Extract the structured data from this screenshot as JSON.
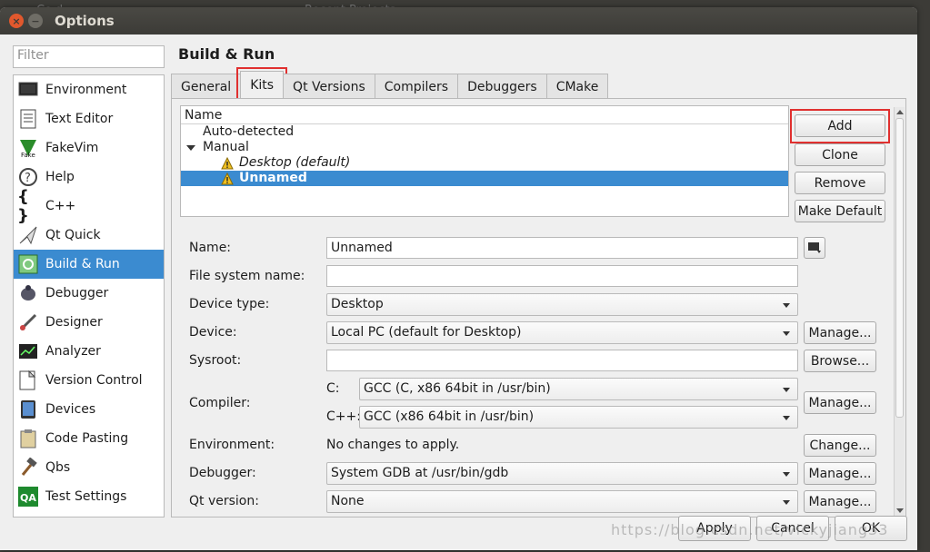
{
  "window": {
    "title": "Options"
  },
  "background": {
    "text_left": "Co.d",
    "text_right": "Recent Projects"
  },
  "filter": {
    "placeholder": "Filter"
  },
  "sidebar": {
    "items": [
      {
        "label": "Environment",
        "icon": "monitor-icon"
      },
      {
        "label": "Text Editor",
        "icon": "text-document-icon"
      },
      {
        "label": "FakeVim",
        "icon": "fakevim-icon"
      },
      {
        "label": "Help",
        "icon": "help-icon"
      },
      {
        "label": "C++",
        "icon": "braces-icon"
      },
      {
        "label": "Qt Quick",
        "icon": "paper-plane-icon"
      },
      {
        "label": "Build & Run",
        "icon": "build-run-icon",
        "selected": true
      },
      {
        "label": "Debugger",
        "icon": "bug-icon"
      },
      {
        "label": "Designer",
        "icon": "designer-icon"
      },
      {
        "label": "Analyzer",
        "icon": "analyzer-icon"
      },
      {
        "label": "Version Control",
        "icon": "version-control-icon"
      },
      {
        "label": "Devices",
        "icon": "device-icon"
      },
      {
        "label": "Code Pasting",
        "icon": "clipboard-icon"
      },
      {
        "label": "Qbs",
        "icon": "hammer-icon"
      },
      {
        "label": "Test Settings",
        "icon": "qa-icon"
      }
    ]
  },
  "main": {
    "heading": "Build & Run",
    "tabs": [
      "General",
      "Kits",
      "Qt Versions",
      "Compilers",
      "Debuggers",
      "CMake"
    ],
    "active_tab": "Kits"
  },
  "tree": {
    "header": "Name",
    "rows": {
      "auto": "Auto-detected",
      "manual": "Manual",
      "desktop": "Desktop (default)",
      "unnamed": "Unnamed"
    }
  },
  "buttons": {
    "add": "Add",
    "clone": "Clone",
    "remove": "Remove",
    "make_default": "Make Default",
    "manage": "Manage...",
    "browse": "Browse...",
    "change": "Change...",
    "apply": "Apply",
    "cancel": "Cancel",
    "ok": "OK"
  },
  "form": {
    "name_label": "Name:",
    "name_value": "Unnamed",
    "fs_label": "File system name:",
    "fs_value": "",
    "device_type_label": "Device type:",
    "device_type_value": "Desktop",
    "device_label": "Device:",
    "device_value": "Local PC (default for Desktop)",
    "sysroot_label": "Sysroot:",
    "sysroot_value": "",
    "compiler_label": "Compiler:",
    "c_label": "C:",
    "c_value": "GCC (C, x86 64bit in /usr/bin)",
    "cpp_label": "C++:",
    "cpp_value": "GCC (x86 64bit in /usr/bin)",
    "env_label": "Environment:",
    "env_value": "No changes to apply.",
    "debugger_label": "Debugger:",
    "debugger_value": "System GDB at /usr/bin/gdb",
    "qt_label": "Qt version:",
    "qt_value": "None"
  },
  "watermark": "https://blog.csdn.net/vickyjiang33",
  "colors": {
    "selection": "#3b8bd0",
    "highlight_box": "#e0302f",
    "titlebar": "#3c3b37"
  }
}
